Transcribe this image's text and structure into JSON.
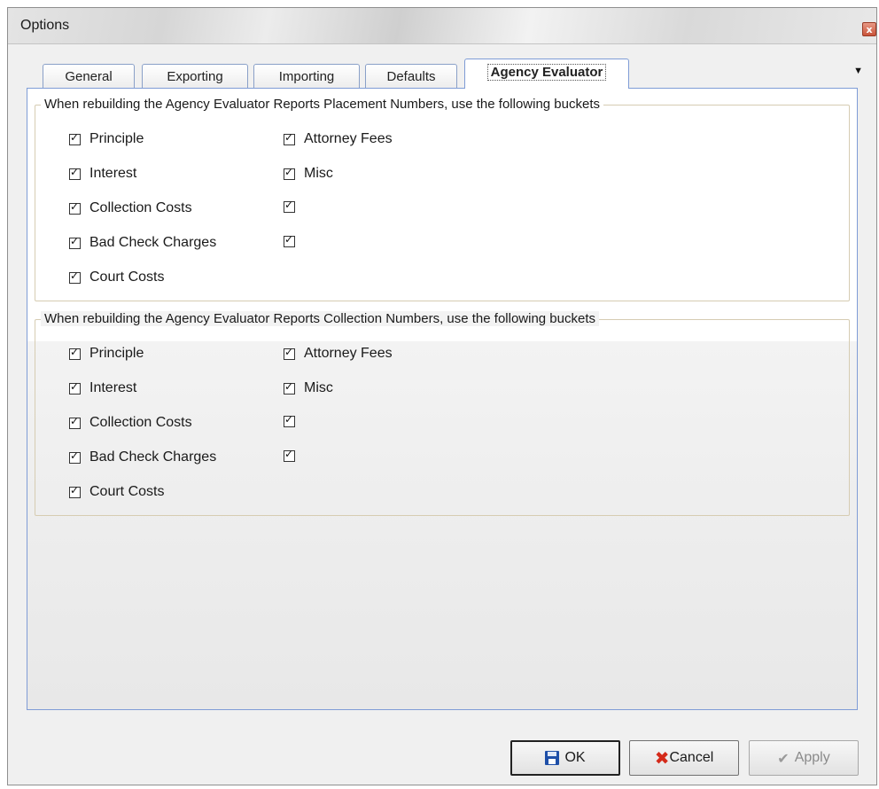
{
  "window": {
    "title": "Options",
    "close_label": "x"
  },
  "tabs": [
    {
      "label": "General"
    },
    {
      "label": "Exporting"
    },
    {
      "label": "Importing"
    },
    {
      "label": "Defaults"
    },
    {
      "label": "Agency Evaluator",
      "active": true
    }
  ],
  "tab_menu": {
    "icon": "dropdown-arrow-icon",
    "glyph": "▼"
  },
  "placement_group": {
    "legend": "When rebuilding the Agency Evaluator Reports Placement Numbers, use the following buckets",
    "left_items": [
      {
        "label": "Principle",
        "checked": true
      },
      {
        "label": "Interest",
        "checked": true
      },
      {
        "label": "Collection Costs",
        "checked": true
      },
      {
        "label": "Bad Check Charges",
        "checked": true
      },
      {
        "label": "Court Costs",
        "checked": true
      }
    ],
    "right_items": [
      {
        "label": "Attorney Fees",
        "checked": true
      },
      {
        "label": "Misc",
        "checked": true
      },
      {
        "label": "",
        "checked": true
      },
      {
        "label": "",
        "checked": true
      }
    ]
  },
  "collection_group": {
    "legend": "When rebuilding the Agency Evaluator Reports Collection Numbers, use the following buckets",
    "left_items": [
      {
        "label": "Principle",
        "checked": true
      },
      {
        "label": "Interest",
        "checked": true
      },
      {
        "label": "Collection Costs",
        "checked": true
      },
      {
        "label": "Bad Check Charges",
        "checked": true
      },
      {
        "label": "Court Costs",
        "checked": true
      }
    ],
    "right_items": [
      {
        "label": "Attorney Fees",
        "checked": true
      },
      {
        "label": "Misc",
        "checked": true
      },
      {
        "label": "",
        "checked": true
      },
      {
        "label": "",
        "checked": true
      }
    ]
  },
  "buttons": {
    "ok": "OK",
    "cancel": "Cancel",
    "apply": "Apply"
  }
}
